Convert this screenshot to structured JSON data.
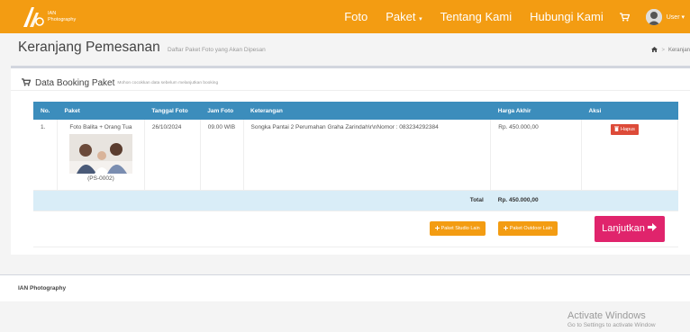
{
  "brand": {
    "line1": "IAN",
    "line2": "Photography"
  },
  "nav": {
    "foto": "Foto",
    "paket": "Paket",
    "caret": "▾",
    "tentang": "Tentang Kami",
    "hubungi": "Hubungi Kami",
    "user": "User"
  },
  "header": {
    "title": "Keranjang Pemesanan",
    "subtitle": "Daftar Paket Foto yang Akan Dipesan",
    "breadcrumb_current": "Keranjan",
    "breadcrumb_sep": ">"
  },
  "box": {
    "title": "Data Booking Paket",
    "subtitle": "Mohon cocokkan data sebelum melanjutkan booking"
  },
  "table": {
    "headers": {
      "no": "No.",
      "paket": "Paket",
      "tanggal": "Tanggal Foto",
      "jam": "Jam Foto",
      "keterangan": "Keterangan",
      "harga": "Harga Akhir",
      "aksi": "Aksi"
    },
    "rows": [
      {
        "no": "1.",
        "paket": "Foto Balita + Orang Tua",
        "kode": "(PS-0002)",
        "tanggal": "26/10/2024",
        "jam": "09.00 WIB",
        "keterangan": "Songka Pantai 2 Perumahan Graha Zarindah\\r\\nNomor : 083234292384",
        "harga": "Rp. 450.000,00",
        "hapus": "Hapus"
      }
    ],
    "total_label": "Total",
    "total_value": "Rp. 450.000,00"
  },
  "buttons": {
    "studio": "Paket Studio Lain",
    "outdoor": "Paket Outdoor Lain",
    "lanjutkan": "Lanjutkan"
  },
  "footer": {
    "text": "IAN Photography"
  },
  "watermark": {
    "title": "Activate Windows",
    "subtitle": "Go to Settings to activate Window"
  },
  "colors": {
    "navbar": "#f39c12",
    "table_header": "#3c8dbc",
    "total_row": "#d9edf7",
    "danger": "#dd4b39",
    "primary_action": "#e0246c"
  },
  "icons": [
    "camera-logo-icon",
    "cart-icon",
    "user-avatar-icon",
    "home-icon",
    "trash-icon",
    "plus-icon",
    "arrow-right-icon"
  ]
}
